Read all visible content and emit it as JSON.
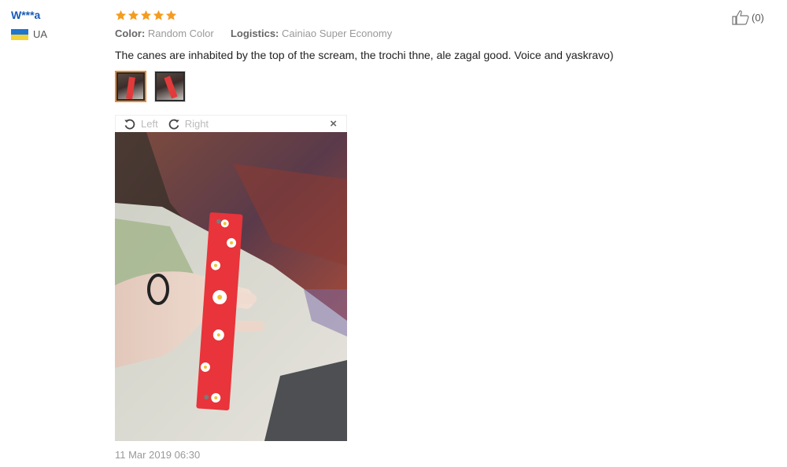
{
  "reviewer": {
    "name": "W***a",
    "country": "UA",
    "flag_colors": [
      "#1f76d2",
      "#f2d338"
    ]
  },
  "review": {
    "rating": 5,
    "star_color": "#f59b1d",
    "color_label": "Color:",
    "color_value": "Random Color",
    "logistics_label": "Logistics:",
    "logistics_value": "Cainiao Super Economy",
    "text": "The canes are inhabited by the top of the scream, the trochi thne, ale zagal good. Voice and yaskravo)",
    "thumbnails_count": 2,
    "date": "11 Mar 2019 06:30"
  },
  "viewer": {
    "rotate_left": "Left",
    "rotate_right": "Right",
    "close": "×"
  },
  "like": {
    "count": "(0)"
  },
  "icons": {
    "rotate_left": "rotate-left-icon",
    "rotate_right": "rotate-right-icon",
    "close": "close-icon",
    "thumbs_up": "thumbs-up-icon",
    "star": "star-icon"
  }
}
